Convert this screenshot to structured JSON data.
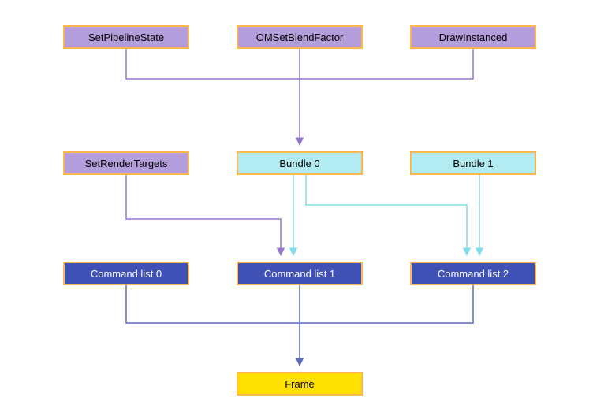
{
  "diagram": {
    "nodes": {
      "set_pipeline_state": {
        "label": "SetPipelineState",
        "fill": "#b39ddb",
        "border": "#ffb74d",
        "text": "#000000"
      },
      "om_set_blend_factor": {
        "label": "OMSetBlendFactor",
        "fill": "#b39ddb",
        "border": "#ffb74d",
        "text": "#000000"
      },
      "draw_instanced": {
        "label": "DrawInstanced",
        "fill": "#b39ddb",
        "border": "#ffb74d",
        "text": "#000000"
      },
      "set_render_targets": {
        "label": "SetRenderTargets",
        "fill": "#b39ddb",
        "border": "#ffb74d",
        "text": "#000000"
      },
      "bundle0": {
        "label": "Bundle 0",
        "fill": "#b2ebf2",
        "border": "#ffb74d",
        "text": "#000000"
      },
      "bundle1": {
        "label": "Bundle 1",
        "fill": "#b2ebf2",
        "border": "#ffb74d",
        "text": "#000000"
      },
      "cmd0": {
        "label": "Command list 0",
        "fill": "#3f51b5",
        "border": "#ffb74d",
        "text": "#ffffff"
      },
      "cmd1": {
        "label": "Command list 1",
        "fill": "#3f51b5",
        "border": "#ffb74d",
        "text": "#ffffff"
      },
      "cmd2": {
        "label": "Command list 2",
        "fill": "#3f51b5",
        "border": "#ffb74d",
        "text": "#ffffff"
      },
      "frame": {
        "label": "Frame",
        "fill": "#ffe000",
        "border": "#ffb74d",
        "text": "#000000"
      }
    },
    "edge_colors": {
      "purple": "#9575cd",
      "teal": "#80deea",
      "blue": "#5c6bc0"
    }
  }
}
